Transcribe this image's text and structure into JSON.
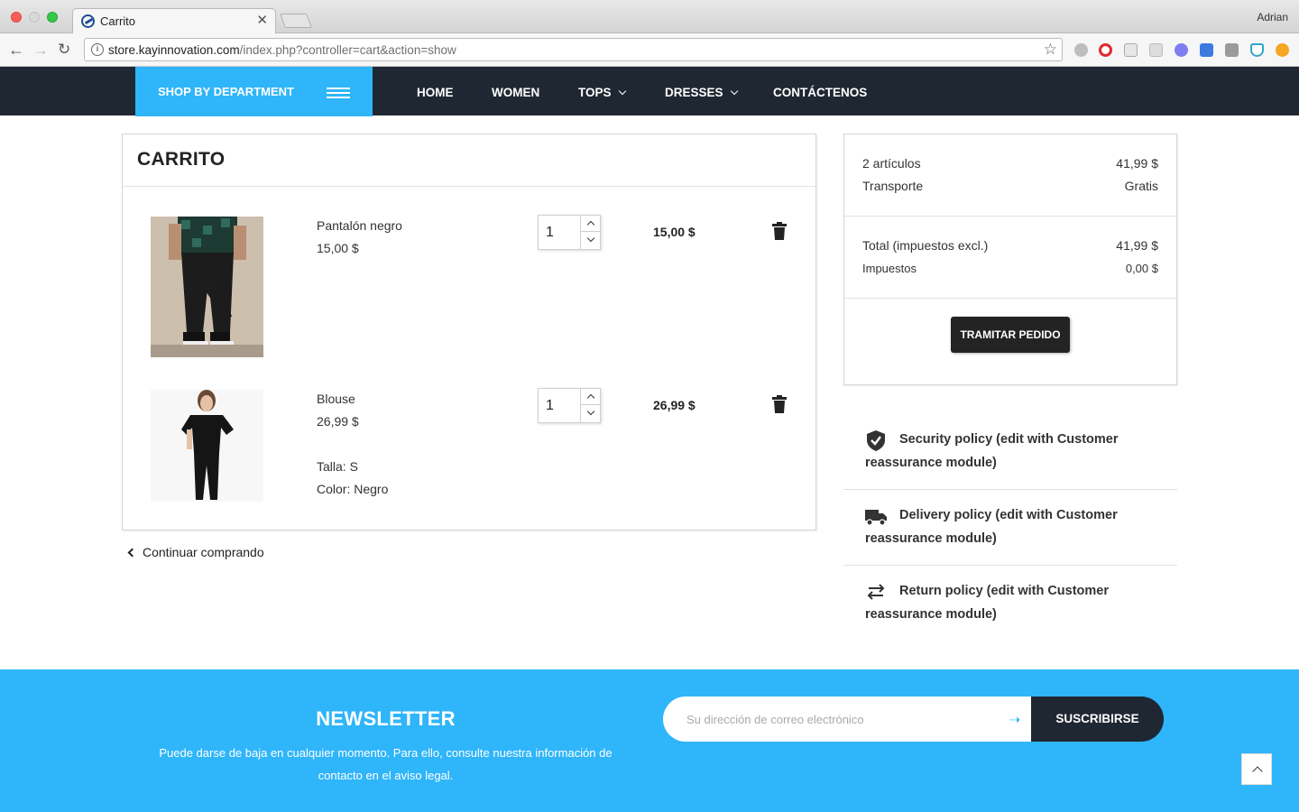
{
  "browser": {
    "tab_title": "Carrito",
    "profile": "Adrian",
    "url_host": "store.kayinnovation.com",
    "url_path": "/index.php?controller=cart&action=show"
  },
  "nav": {
    "shop_by_department": "SHOP BY DEPARTMENT",
    "items": [
      {
        "label": "HOME",
        "dropdown": false
      },
      {
        "label": "WOMEN",
        "dropdown": false
      },
      {
        "label": "TOPS",
        "dropdown": true
      },
      {
        "label": "DRESSES",
        "dropdown": true
      },
      {
        "label": "CONTÁCTENOS",
        "dropdown": false
      }
    ]
  },
  "cart": {
    "title": "CARRITO",
    "items": [
      {
        "name": "Pantalón negro",
        "price": "15,00 $",
        "quantity": "1",
        "line_total": "15,00 $",
        "attributes": []
      },
      {
        "name": "Blouse",
        "price": "26,99 $",
        "quantity": "1",
        "line_total": "26,99 $",
        "attributes": [
          "Talla: S",
          "Color: Negro"
        ]
      }
    ],
    "continue_shopping": "Continuar comprando"
  },
  "summary": {
    "items_label": "2 artículos",
    "items_value": "41,99 $",
    "shipping_label": "Transporte",
    "shipping_value": "Gratis",
    "total_label": "Total (impuestos excl.)",
    "total_value": "41,99 $",
    "taxes_label": "Impuestos",
    "taxes_value": "0,00 $",
    "checkout_button": "TRAMITAR PEDIDO"
  },
  "reassurance": [
    {
      "icon": "shield-check-icon",
      "text": "Security policy (edit with Customer reassurance module)"
    },
    {
      "icon": "truck-icon",
      "text": "Delivery policy (edit with Customer reassurance module)"
    },
    {
      "icon": "swap-arrows-icon",
      "text": "Return policy (edit with Customer reassurance module)"
    }
  ],
  "newsletter": {
    "title": "NEWSLETTER",
    "description": "Puede darse de baja en cualquier momento. Para ello, consulte nuestra información de contacto en el aviso legal.",
    "placeholder": "Su dirección de correo electrónico",
    "button": "SUSCRIBIRSE"
  },
  "colors": {
    "accent": "#2fb5f9",
    "header_dark": "#1f2733",
    "button_dark": "#232323"
  }
}
